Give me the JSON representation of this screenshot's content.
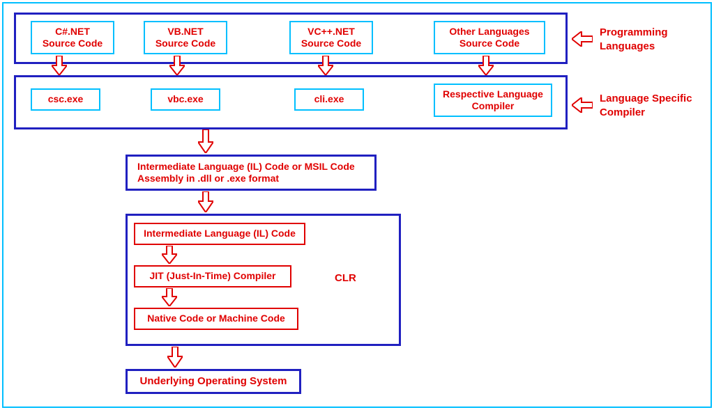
{
  "sources": {
    "csharp": "C#.NET\nSource Code",
    "vb": "VB.NET\nSource Code",
    "vcpp": "VC++.NET\nSource Code",
    "other": "Other Languages\nSource Code"
  },
  "compilers": {
    "csc": "csc.exe",
    "vbc": "vbc.exe",
    "cli": "cli.exe",
    "respective": "Respective Language\nCompiler"
  },
  "il": "Intermediate Language (IL) Code or MSIL Code\nAssembly in .dll or .exe format",
  "clr": {
    "label": "CLR",
    "il": "Intermediate Language (IL) Code",
    "jit": "JIT (Just-In-Time) Compiler",
    "native": "Native Code or Machine Code"
  },
  "os": "Underlying Operating System",
  "labels": {
    "programming": "Programming\nLanguages",
    "compiler": "Language Specific\nCompiler"
  }
}
